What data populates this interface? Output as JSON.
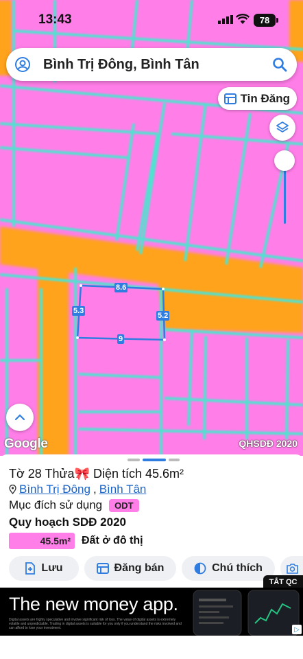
{
  "status_bar": {
    "time": "13:43",
    "battery": "78"
  },
  "search": {
    "query": "Bình Trị Đông, Bình Tân"
  },
  "map": {
    "tin_dang_label": "Tin Đăng",
    "attribution": "Google",
    "layer_name": "QHSDĐ 2020",
    "parcel_dimensions": {
      "top": "8.6",
      "left": "5.3",
      "right": "5.2",
      "bottom": "9"
    },
    "colors": {
      "residential": "#ff7ee8",
      "road": "#ffa31a",
      "boundary": "#4fe2d0",
      "parcel_outline": "#2f7de1"
    }
  },
  "parcel": {
    "title": "Tờ 28 Thửa🎀 Diện tích 45.6m²",
    "ward": "Bình Trị Đông",
    "separator": ",",
    "district": "Bình Tân",
    "purpose_label": "Mục đích sử dụng",
    "purpose_code": "ODT",
    "plan_title": "Quy hoạch SDĐ 2020",
    "plan_area": "45.5m²",
    "plan_type": "Đất ở đô thị"
  },
  "actions": {
    "save": "Lưu",
    "post_sale": "Đăng bán",
    "legend": "Chú thích"
  },
  "ad": {
    "close_label": "TẮT QC",
    "headline": "The new money app.",
    "fine_print": "Digital assets are highly speculative and involve significant risk of loss. The value of digital assets is extremely volatile and unpredictable. Trading in digital assets is suitable for you only if you understand the risks involved and can afford to lose your investment."
  }
}
